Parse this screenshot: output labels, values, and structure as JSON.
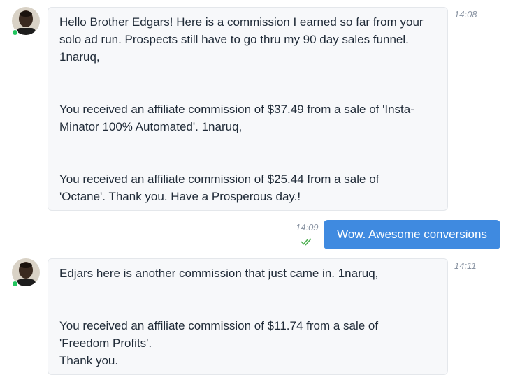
{
  "messages": [
    {
      "direction": "incoming",
      "time": "14:08",
      "avatar_icon": "user-avatar-photo",
      "lines": [
        "Hello Brother Edgars! Here is a commission I earned so far from your",
        "solo ad run. Prospects still have to go thru my 90 day sales funnel.",
        "1naruq,",
        "",
        "",
        "You received an affiliate commission of $37.49 from a sale of 'Insta-",
        "Minator 100% Automated'. 1naruq,",
        "",
        "",
        "You received an affiliate commission of $25.44 from a sale of",
        "'Octane'. Thank you. Have a Prosperous day.!"
      ]
    },
    {
      "direction": "outgoing",
      "time": "14:09",
      "status_icon": "double-check-icon",
      "text": "Wow. Awesome conversions"
    },
    {
      "direction": "incoming",
      "time": "14:11",
      "avatar_icon": "user-avatar-photo",
      "lines": [
        "Edjars here is another commission that just came in. 1naruq,",
        "",
        "",
        "You received an affiliate commission of $11.74 from a sale of",
        "'Freedom Profits'.",
        "Thank you."
      ]
    }
  ],
  "colors": {
    "outgoing_bubble": "#3f8ae0",
    "incoming_bubble": "#f7f8fa",
    "online_status": "#22c55e",
    "read_check": "#4caf50",
    "timestamp": "#8a94a3"
  }
}
